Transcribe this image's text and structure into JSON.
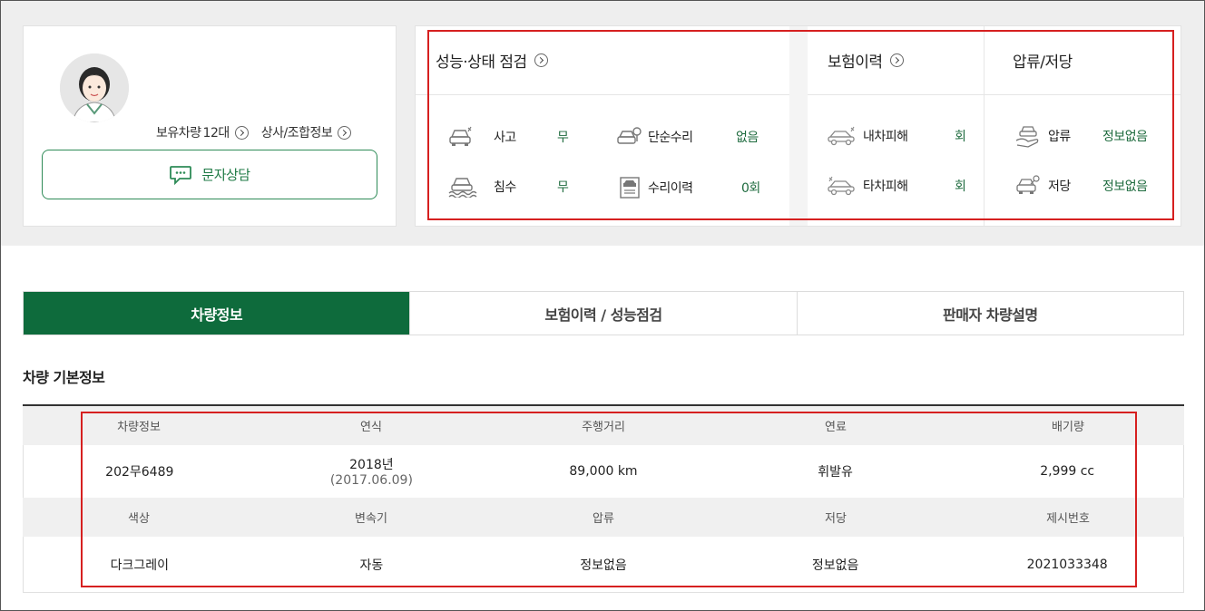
{
  "seller": {
    "owned_label": "보유차량",
    "owned_count": "12대",
    "dealer_info": "상사/조합정보",
    "sms_button": "문자상담"
  },
  "summary": {
    "performance": {
      "title": "성능·상태 점검",
      "items": [
        {
          "label": "사고",
          "value": "무",
          "icon": "car-accident-icon"
        },
        {
          "label": "단순수리",
          "value": "없음",
          "icon": "car-repair-icon"
        },
        {
          "label": "침수",
          "value": "무",
          "icon": "car-flood-icon"
        },
        {
          "label": "수리이력",
          "value": "0회",
          "icon": "repair-history-icon"
        }
      ]
    },
    "insurance": {
      "title": "보험이력",
      "items": [
        {
          "label": "내차피해",
          "value": "회",
          "icon": "my-car-damage-icon"
        },
        {
          "label": "타차피해",
          "value": "회",
          "icon": "other-car-damage-icon"
        }
      ]
    },
    "seizure": {
      "title": "압류/저당",
      "items": [
        {
          "label": "압류",
          "value": "정보없음",
          "icon": "seizure-icon"
        },
        {
          "label": "저당",
          "value": "정보없음",
          "icon": "mortgage-icon"
        }
      ]
    }
  },
  "tabs": [
    {
      "label": "차량정보",
      "active": true
    },
    {
      "label": "보험이력 / 성능점검",
      "active": false
    },
    {
      "label": "판매자 차량설명",
      "active": false
    }
  ],
  "basic_info": {
    "title": "차량 기본정보",
    "row1_headers": [
      "차량정보",
      "연식",
      "주행거리",
      "연료",
      "배기량"
    ],
    "row1_values": [
      "202무6489",
      "2018년",
      "89,000 km",
      "휘발유",
      "2,999 cc"
    ],
    "year_sub": "(2017.06.09)",
    "row2_headers": [
      "색상",
      "변속기",
      "압류",
      "저당",
      "제시번호"
    ],
    "row2_values": [
      "다크그레이",
      "자동",
      "정보없음",
      "정보없음",
      "2021033348"
    ]
  },
  "colors": {
    "accent_green": "#0e6b3c",
    "value_green": "#1e6b3e",
    "highlight_red": "#d62020"
  }
}
